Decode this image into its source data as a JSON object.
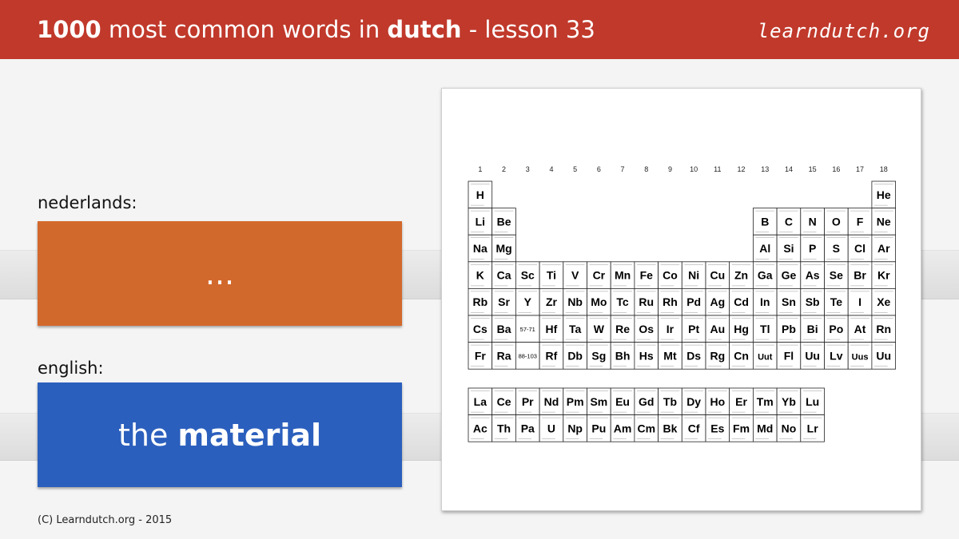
{
  "header": {
    "title_count": "1000",
    "title_mid": " most common words in ",
    "title_lang": "dutch",
    "title_lesson": " - lesson 33",
    "logo": "learndutch.org"
  },
  "labels": {
    "dutch": "nederlands:",
    "english": "english:"
  },
  "cards": {
    "dutch_text": "...",
    "english_prefix": "the ",
    "english_word": "material"
  },
  "footer": "(C) Learndutch.org - 2015",
  "periodic_table": {
    "groups": [
      "1",
      "2",
      "3",
      "4",
      "5",
      "6",
      "7",
      "8",
      "9",
      "10",
      "11",
      "12",
      "13",
      "14",
      "15",
      "16",
      "17",
      "18"
    ],
    "rows": [
      [
        [
          1,
          "H"
        ],
        [
          18,
          "He"
        ]
      ],
      [
        [
          1,
          "Li"
        ],
        [
          2,
          "Be"
        ],
        [
          13,
          "B"
        ],
        [
          14,
          "C"
        ],
        [
          15,
          "N"
        ],
        [
          16,
          "O"
        ],
        [
          17,
          "F"
        ],
        [
          18,
          "Ne"
        ]
      ],
      [
        [
          1,
          "Na"
        ],
        [
          2,
          "Mg"
        ],
        [
          13,
          "Al"
        ],
        [
          14,
          "Si"
        ],
        [
          15,
          "P"
        ],
        [
          16,
          "S"
        ],
        [
          17,
          "Cl"
        ],
        [
          18,
          "Ar"
        ]
      ],
      [
        [
          1,
          "K"
        ],
        [
          2,
          "Ca"
        ],
        [
          3,
          "Sc"
        ],
        [
          4,
          "Ti"
        ],
        [
          5,
          "V"
        ],
        [
          6,
          "Cr"
        ],
        [
          7,
          "Mn"
        ],
        [
          8,
          "Fe"
        ],
        [
          9,
          "Co"
        ],
        [
          10,
          "Ni"
        ],
        [
          11,
          "Cu"
        ],
        [
          12,
          "Zn"
        ],
        [
          13,
          "Ga"
        ],
        [
          14,
          "Ge"
        ],
        [
          15,
          "As"
        ],
        [
          16,
          "Se"
        ],
        [
          17,
          "Br"
        ],
        [
          18,
          "Kr"
        ]
      ],
      [
        [
          1,
          "Rb"
        ],
        [
          2,
          "Sr"
        ],
        [
          3,
          "Y"
        ],
        [
          4,
          "Zr"
        ],
        [
          5,
          "Nb"
        ],
        [
          6,
          "Mo"
        ],
        [
          7,
          "Tc"
        ],
        [
          8,
          "Ru"
        ],
        [
          9,
          "Rh"
        ],
        [
          10,
          "Pd"
        ],
        [
          11,
          "Ag"
        ],
        [
          12,
          "Cd"
        ],
        [
          13,
          "In"
        ],
        [
          14,
          "Sn"
        ],
        [
          15,
          "Sb"
        ],
        [
          16,
          "Te"
        ],
        [
          17,
          "I"
        ],
        [
          18,
          "Xe"
        ]
      ],
      [
        [
          1,
          "Cs"
        ],
        [
          2,
          "Ba"
        ],
        [
          3,
          "57-71"
        ],
        [
          4,
          "Hf"
        ],
        [
          5,
          "Ta"
        ],
        [
          6,
          "W"
        ],
        [
          7,
          "Re"
        ],
        [
          8,
          "Os"
        ],
        [
          9,
          "Ir"
        ],
        [
          10,
          "Pt"
        ],
        [
          11,
          "Au"
        ],
        [
          12,
          "Hg"
        ],
        [
          13,
          "Tl"
        ],
        [
          14,
          "Pb"
        ],
        [
          15,
          "Bi"
        ],
        [
          16,
          "Po"
        ],
        [
          17,
          "At"
        ],
        [
          18,
          "Rn"
        ]
      ],
      [
        [
          1,
          "Fr"
        ],
        [
          2,
          "Ra"
        ],
        [
          3,
          "88-103"
        ],
        [
          4,
          "Rf"
        ],
        [
          5,
          "Db"
        ],
        [
          6,
          "Sg"
        ],
        [
          7,
          "Bh"
        ],
        [
          8,
          "Hs"
        ],
        [
          9,
          "Mt"
        ],
        [
          10,
          "Ds"
        ],
        [
          11,
          "Rg"
        ],
        [
          12,
          "Cn"
        ],
        [
          13,
          "Uut"
        ],
        [
          14,
          "Fl"
        ],
        [
          15,
          "Uu"
        ],
        [
          16,
          "Lv"
        ],
        [
          17,
          "Uus"
        ],
        [
          18,
          "Uu"
        ]
      ]
    ],
    "lanthanides": [
      "La",
      "Ce",
      "Pr",
      "Nd",
      "Pm",
      "Sm",
      "Eu",
      "Gd",
      "Tb",
      "Dy",
      "Ho",
      "Er",
      "Tm",
      "Yb",
      "Lu"
    ],
    "actinides": [
      "Ac",
      "Th",
      "Pa",
      "U",
      "Np",
      "Pu",
      "Am",
      "Cm",
      "Bk",
      "Cf",
      "Es",
      "Fm",
      "Md",
      "No",
      "Lr"
    ]
  }
}
